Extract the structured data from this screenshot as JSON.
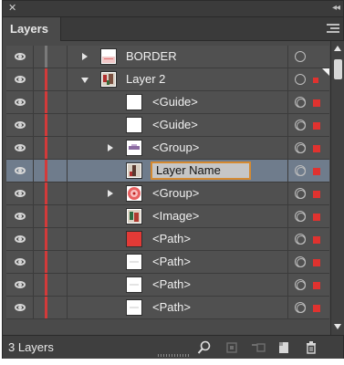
{
  "panel": {
    "tab_label": "Layers",
    "footer_count": "3 Layers",
    "accent_color": "#d23a3a",
    "selection_color": "#e0322f",
    "selected_row_color": "#6f7c8c"
  },
  "layers": [
    {
      "label": "BORDER",
      "indent": "top",
      "expander": "collapsed",
      "thumb": "border-thumb",
      "color": "gray"
    },
    {
      "label": "Layer 2",
      "indent": "top",
      "expander": "expanded",
      "thumb": "photo-thumb",
      "color": "red"
    },
    {
      "label": "<Guide>",
      "indent": "child",
      "expander": "none",
      "thumb": "blank-thumb",
      "color": "red"
    },
    {
      "label": "<Guide>",
      "indent": "child",
      "expander": "none",
      "thumb": "blank-thumb",
      "color": "red"
    },
    {
      "label": "<Group>",
      "indent": "child",
      "expander": "collapsed",
      "thumb": "group-thumb",
      "color": "red"
    },
    {
      "label": "Layer Name",
      "indent": "child",
      "expander": "none",
      "thumb": "photo-thumb",
      "color": "red",
      "editing": true
    },
    {
      "label": "<Group>",
      "indent": "child",
      "expander": "collapsed",
      "thumb": "pattern-thumb",
      "color": "red"
    },
    {
      "label": "<Image>",
      "indent": "child",
      "expander": "none",
      "thumb": "photo-thumb",
      "color": "red"
    },
    {
      "label": "<Path>",
      "indent": "child",
      "expander": "none",
      "thumb": "red-thumb",
      "color": "red"
    },
    {
      "label": "<Path>",
      "indent": "child",
      "expander": "none",
      "thumb": "line-thumb",
      "color": "red"
    },
    {
      "label": "<Path>",
      "indent": "child",
      "expander": "none",
      "thumb": "line-thumb",
      "color": "red"
    },
    {
      "label": "<Path>",
      "indent": "child",
      "expander": "none",
      "thumb": "line-thumb",
      "color": "red"
    }
  ],
  "footer_icons": [
    "search-icon",
    "make-clip-mask-icon",
    "create-sublayer-icon",
    "new-layer-icon",
    "trash-icon"
  ]
}
